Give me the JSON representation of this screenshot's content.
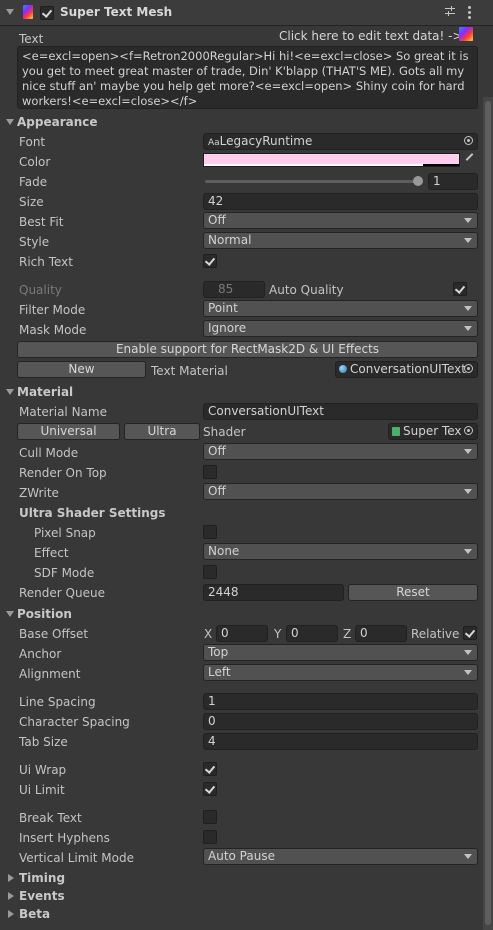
{
  "header": {
    "title": "Super Text Mesh",
    "enabled": true
  },
  "text_section": {
    "label": "Text",
    "edit_link": "Click here to edit text data! ->",
    "value": "<e=excl=open><f=Retron2000Regular>Hi hi!<e=excl=close> So great it is you get to meet great master of trade, Din' K'blapp (THAT'S ME). Gots all my nice stuff an' maybe you help get more?<e=excl=open> Shiny coin for hard workers!<e=excl=close></f>"
  },
  "appearance": {
    "title": "Appearance",
    "font_label": "Font",
    "font_prefix": "Aa",
    "font_value": "LegacyRuntime",
    "color_label": "Color",
    "color_value": "#ffcdee",
    "fade_label": "Fade",
    "fade_value": "1",
    "size_label": "Size",
    "size_value": "42",
    "best_fit_label": "Best Fit",
    "best_fit_value": "Off",
    "style_label": "Style",
    "style_value": "Normal",
    "rich_text_label": "Rich Text",
    "rich_text_checked": true,
    "quality_label": "Quality",
    "quality_value": "85",
    "auto_quality_label": "Auto Quality",
    "auto_quality_checked": true,
    "filter_mode_label": "Filter Mode",
    "filter_mode_value": "Point",
    "mask_mode_label": "Mask Mode",
    "mask_mode_value": "Ignore",
    "rectmask_button": "Enable support for RectMask2D & UI Effects",
    "new_button": "New",
    "text_material_label": "Text Material",
    "text_material_value": "ConversationUIText"
  },
  "material": {
    "title": "Material",
    "name_label": "Material Name",
    "name_value": "ConversationUIText",
    "universal_button": "Universal",
    "ultra_button": "Ultra",
    "shader_label": "Shader",
    "shader_value": "Super Tex",
    "cull_mode_label": "Cull Mode",
    "cull_mode_value": "Off",
    "render_on_top_label": "Render On Top",
    "zwrite_label": "ZWrite",
    "zwrite_value": "Off",
    "ultra_settings_label": "Ultra Shader Settings",
    "pixel_snap_label": "Pixel Snap",
    "effect_label": "Effect",
    "effect_value": "None",
    "sdf_mode_label": "SDF Mode",
    "render_queue_label": "Render Queue",
    "render_queue_value": "2448",
    "reset_button": "Reset"
  },
  "position": {
    "title": "Position",
    "base_offset_label": "Base Offset",
    "x_label": "X",
    "x_value": "0",
    "y_label": "Y",
    "y_value": "0",
    "z_label": "Z",
    "z_value": "0",
    "relative_label": "Relative",
    "relative_checked": true,
    "anchor_label": "Anchor",
    "anchor_value": "Top",
    "alignment_label": "Alignment",
    "alignment_value": "Left",
    "line_spacing_label": "Line Spacing",
    "line_spacing_value": "1",
    "char_spacing_label": "Character Spacing",
    "char_spacing_value": "0",
    "tab_size_label": "Tab Size",
    "tab_size_value": "4",
    "ui_wrap_label": "Ui Wrap",
    "ui_wrap_checked": true,
    "ui_limit_label": "Ui Limit",
    "ui_limit_checked": true,
    "break_text_label": "Break Text",
    "insert_hyphens_label": "Insert Hyphens",
    "vertical_limit_label": "Vertical Limit Mode",
    "vertical_limit_value": "Auto Pause"
  },
  "collapsed_sections": {
    "timing": "Timing",
    "events": "Events",
    "beta": "Beta"
  }
}
